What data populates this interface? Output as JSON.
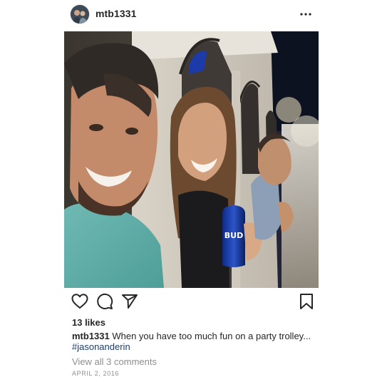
{
  "post": {
    "username": "mtb1331",
    "likes": "13 likes",
    "caption_user": "mtb1331",
    "caption_text": " When you have too much fun on a party trolley...",
    "hashtag": "#jasonanderin",
    "comments_link": "View all 3 comments",
    "date": "APRIL 2, 2016"
  },
  "icons": {
    "avatar": "profile-photo",
    "more": "ellipsis-icon",
    "like": "heart-icon",
    "comment": "speech-bubble-icon",
    "share": "paper-plane-icon",
    "save": "bookmark-icon"
  },
  "colors": {
    "text": "#262626",
    "muted": "#8e8e8e",
    "hashtag": "#1c3d6e"
  }
}
